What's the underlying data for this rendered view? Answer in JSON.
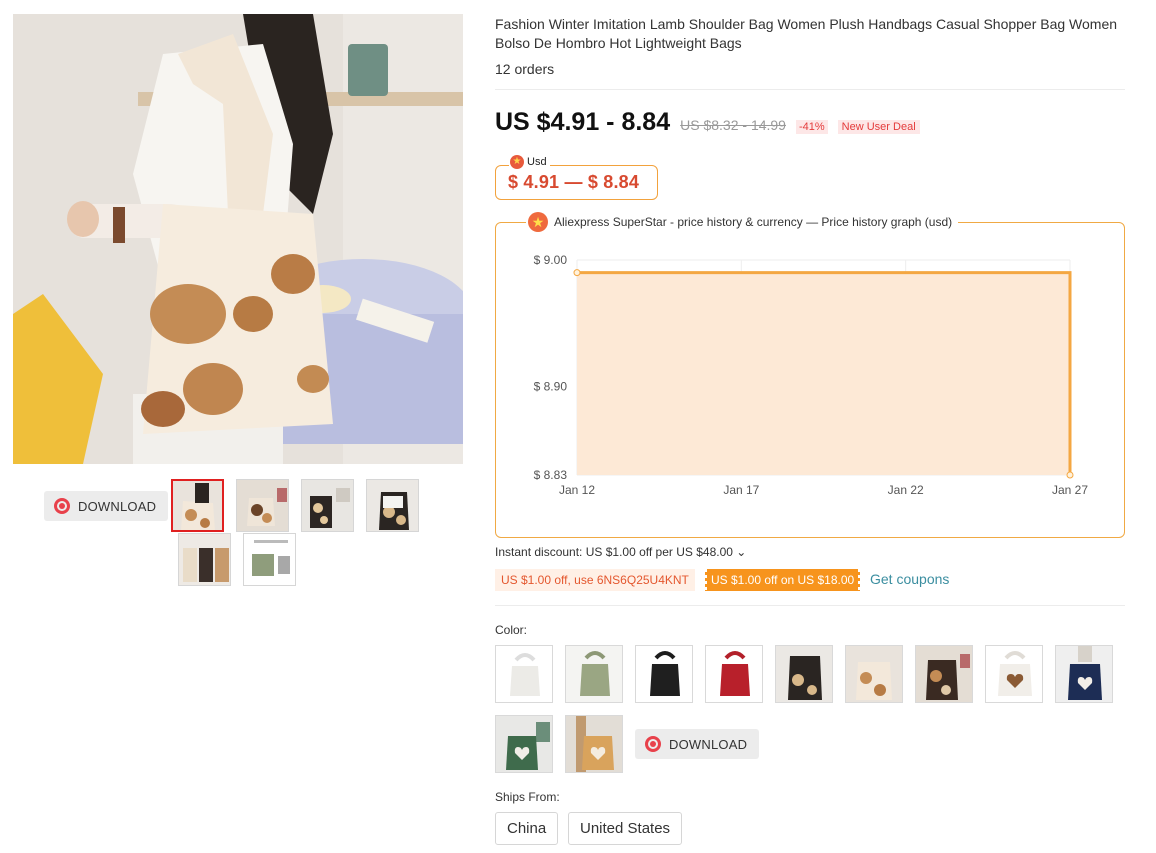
{
  "gallery": {
    "download_label": "DOWNLOAD"
  },
  "product": {
    "title": "Fashion Winter Imitation Lamb Shoulder Bag Women Plush Handbags Casual Shopper Bag Women Bolso De Hombro Hot Lightweight Bags",
    "orders": "12 orders",
    "price": "US $4.91 - 8.84",
    "old_price": "US $8.32 - 14.99",
    "discount": "-41%",
    "deal_badge": "New User Deal"
  },
  "superstar": {
    "currency_label": "Usd",
    "range": "$ 4.91 — $ 8.84",
    "graph_title": "Aliexpress SuperStar - price history & currency — Price history graph (usd)"
  },
  "chart_data": {
    "type": "area",
    "title": "",
    "xlabel": "",
    "ylabel": "",
    "x_ticks": [
      "Jan 12",
      "Jan 17",
      "Jan 22",
      "Jan 27"
    ],
    "y_ticks": [
      "$ 9.00",
      "$ 8.90",
      "$ 8.83"
    ],
    "ylim": [
      8.83,
      9.0
    ],
    "series": [
      {
        "x": [
          "Jan 12",
          "Jan 27",
          "Jan 27"
        ],
        "values": [
          8.99,
          8.99,
          8.83
        ]
      }
    ],
    "grid": true,
    "colors": {
      "line": "#f4a742",
      "fill": "#fde9d6"
    }
  },
  "discounts": {
    "instant": "Instant discount: US $1.00 off per US $48.00 ⌄",
    "coupon1": "US $1.00 off, use 6NS6Q25U4KNT",
    "coupon2": "US $1.00 off on US $18.00",
    "get_coupons": "Get coupons"
  },
  "options": {
    "color_label": "Color:",
    "download_label": "DOWNLOAD",
    "ships_label": "Ships From:",
    "ships": [
      "China",
      "United States"
    ]
  }
}
